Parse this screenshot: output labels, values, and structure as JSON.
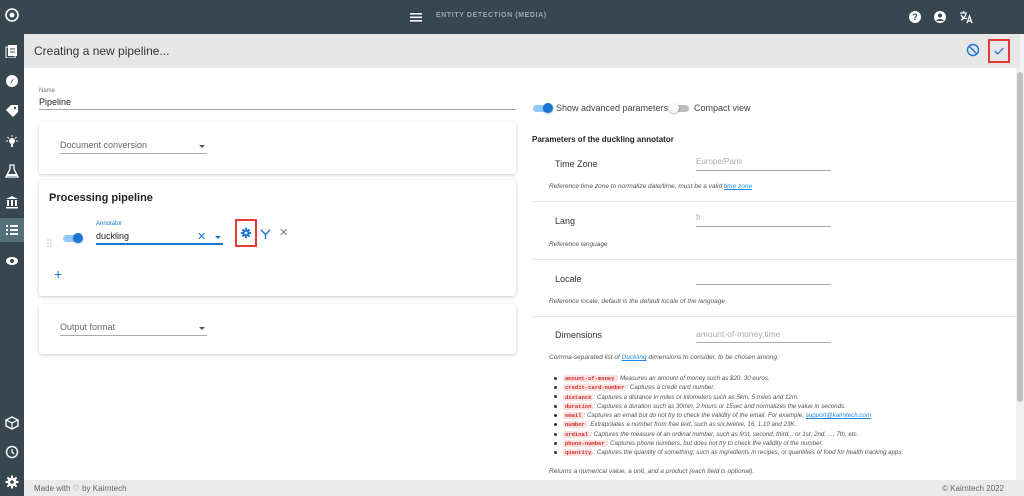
{
  "app": {
    "title": "ENTITY DETECTION (MEDIA)",
    "icons": [
      "logo-icon",
      "documents-icon",
      "compass-icon",
      "tag-icon",
      "lightbulb-icon",
      "flask-icon",
      "bank-icon",
      "list-icon",
      "eye-icon",
      "cube-icon",
      "history-icon",
      "settings-icon"
    ]
  },
  "header": {
    "title": "Creating a new pipeline..."
  },
  "form": {
    "name_label": "Name",
    "name_value": "Pipeline",
    "document_conversion": "Document conversion",
    "processing_title": "Processing pipeline",
    "annotator_label": "Annotator",
    "annotator_value": "duckling",
    "output_format": "Output format"
  },
  "options": {
    "advanced": "Show advanced parameters",
    "advanced_on": true,
    "compact": "Compact view",
    "compact_on": false
  },
  "params": {
    "heading": "Parameters of the duckling annotator",
    "timezone": {
      "label": "Time Zone",
      "placeholder": "Europe/Paris",
      "desc": "Reference time zone to normalize date/time, must be a valid ",
      "link": "time zone"
    },
    "lang": {
      "label": "Lang",
      "placeholder": "fr",
      "desc": "Reference language"
    },
    "locale": {
      "label": "Locale",
      "placeholder": "",
      "desc": "Reference locale, default is the default locale of the language"
    },
    "dimensions": {
      "label": "Dimensions",
      "placeholder": "amount-of-money,time",
      "desc_pre": "Comma-separated list of ",
      "desc_link": "Duckling",
      "desc_post": " dimensions to consider, to be chosen among:",
      "items": [
        {
          "code": "amount-of-money",
          "text": ": Measures an amount of money such as $20, 30 euros."
        },
        {
          "code": "credit-card-number",
          "text": ": Captures a credit card number."
        },
        {
          "code": "distance",
          "text": ": Captures a distance in miles or kilometers such as 5km, 5 miles and 12m."
        },
        {
          "code": "duration",
          "text": ": Captures a duration such as 30min, 2 hours or 15sec and normalizes the value in seconds."
        },
        {
          "code": "email",
          "text": ": Captures an email but do not try to check the validity of the email. For example, ",
          "link": "support@kairntech.com"
        },
        {
          "code": "number",
          "text": ": Extrapolates a number from free text, such as six,twelve, 16, 1.10 and 23K."
        },
        {
          "code": "ordinal",
          "text": ": Captures the measure of an ordinal number, such as first, second, third... or 1st, 2nd, ..., 7th, etc."
        },
        {
          "code": "phone-number",
          "text": ": Captures phone numbers, but does not try to check the validity of the number."
        },
        {
          "code": "quantity",
          "text": ": Captures the quantity of something; such as ingredients in recipes, or quantities of food for health tracking apps."
        }
      ],
      "footer_note": "Returns a numerical value, a unit, and a product (each field is optional)."
    }
  },
  "footer": {
    "left": "Made with ♡ by Kairntech",
    "right": "©   Kairntech 2022"
  },
  "colors": {
    "accent": "#1976d2",
    "highlight": "#e53935",
    "sidebar": "#37474f"
  }
}
